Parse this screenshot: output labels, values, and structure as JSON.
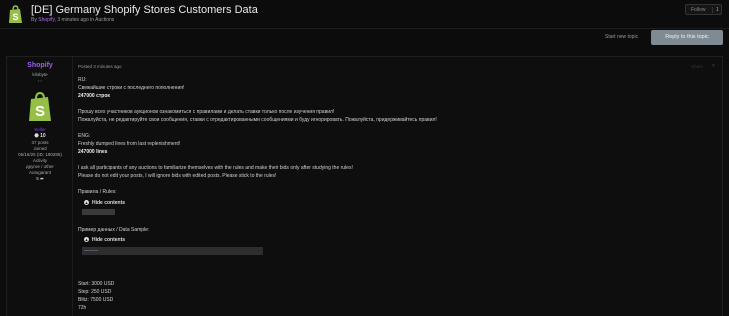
{
  "header": {
    "title": "[DE] Germany Shopify Stores Customers Data",
    "by_label": "By ",
    "author": "Shopify",
    "meta": ", 3 minutes ago in Auctions",
    "follow_label": "Follow",
    "follow_count": "1"
  },
  "actions": {
    "start_new_topic": "Start new topic",
    "reply": "Reply to this topic"
  },
  "author_panel": {
    "name": "Shopify",
    "title": "kilobyte",
    "stars": "• •",
    "badge": "Seller",
    "reputation": "10",
    "posts": "37 posts",
    "status": "Joined",
    "joined": "05/16/25 (ID: 190285)",
    "activity_label": "Activity",
    "activity": "другое / other",
    "autogarant_label": "Autogarant",
    "autogarant": "5 ⬌"
  },
  "post": {
    "posted": "Posted 3 minutes ago",
    "share_text": "Share",
    "lines": [
      "RU:",
      "Свежайшие строки с последнего пополнения!",
      "247000 строк",
      "Прошу всех участников аукционов ознакомиться с правилами и делать ставки только после изучения правил!",
      "Пожалуйста, не редактируйте свои сообщения, ставки с отредактированными сообщениями и буду игнорировать. Пожалуйста, придерживайтесь правил!",
      "ENG:",
      "Freshly dumped lines from last replenishment!",
      "247000 lines",
      "I ask all participants of any auctions to familiarize themselves with the rules and make their bids only after studying the rules!",
      "Please do not edit your posts, I will ignore bids with edited posts. Please stick to the rules!",
      "Правила / Rules:",
      "Пример данных / Data Sample:",
      "Start: 3000 USD",
      "Step: 250 USD",
      "Blitz: 7500 USD",
      "72h"
    ],
    "hide_contents": "Hide contents"
  },
  "colors": {
    "background": "#0c0c0c",
    "accent": "#9a5df0",
    "reply_button": "#7f8a93",
    "shopify_green": "#95bf47"
  }
}
